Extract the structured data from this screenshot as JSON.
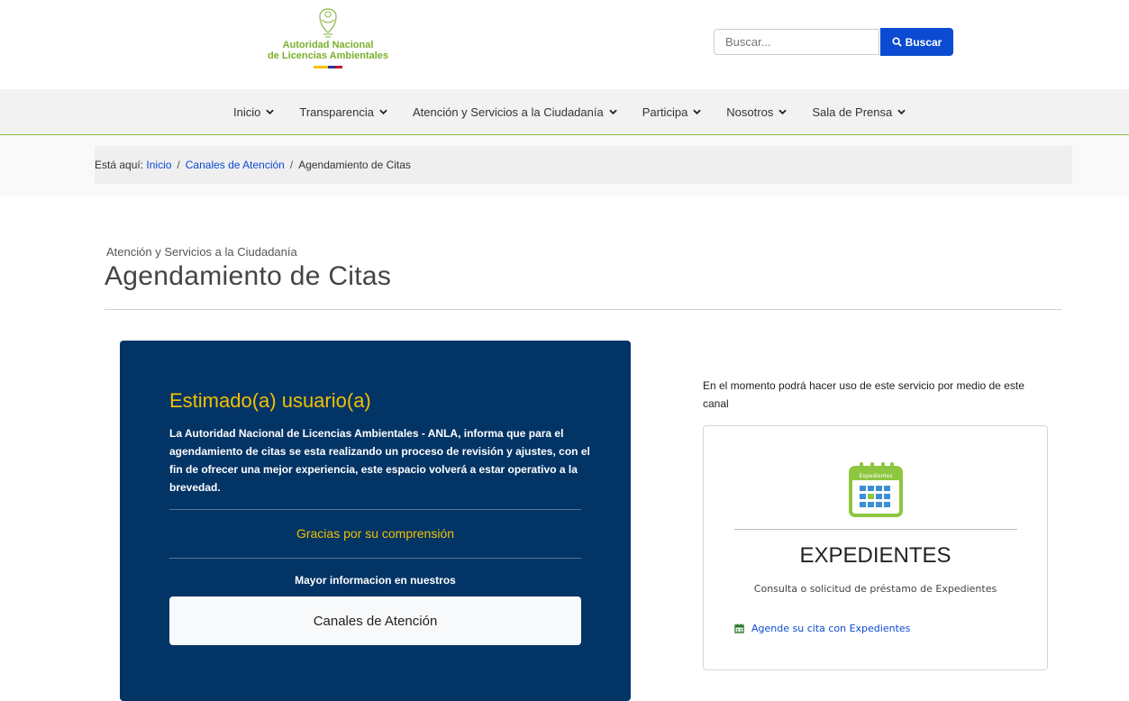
{
  "header": {
    "logo_line1": "Autoridad Nacional",
    "logo_line2": "de Licencias Ambientales",
    "search_placeholder": "Buscar...",
    "search_button": "Buscar"
  },
  "nav": {
    "items": [
      {
        "label": "Inicio"
      },
      {
        "label": "Transparencia"
      },
      {
        "label": "Atención y Servicios a la Ciudadanía"
      },
      {
        "label": "Participa"
      },
      {
        "label": "Nosotros"
      },
      {
        "label": "Sala de Prensa"
      }
    ]
  },
  "breadcrumb": {
    "prefix": "Está aquí:",
    "links": [
      "Inicio",
      "Canales de Atención"
    ],
    "separator": "/",
    "current": "Agendamiento de Citas"
  },
  "page": {
    "kicker": "Atención y Servicios a la Ciudadanía",
    "title": "Agendamiento de Citas"
  },
  "notice": {
    "heading": "Estimado(a) usuario(a)",
    "body": "La Autoridad Nacional de Licencias Ambientales - ANLA, informa que para el agendamiento de citas se esta realizando un proceso de revisión y ajustes, con el fin de ofrecer una mejor experiencia, este espacio volverá a estar operativo a la brevedad.",
    "thanks": "Gracias por su comprensión",
    "more": "Mayor informacion en nuestros",
    "button": "Canales de Atención"
  },
  "side": {
    "intro": "En el momento podrá hacer uso de este servicio por medio de este canal",
    "card": {
      "icon_label": "Expedientes",
      "title": "EXPEDIENTES",
      "description": "Consulta o solicitud de préstamo de Expedientes",
      "link": "Agende su cita con Expedientes"
    }
  },
  "colors": {
    "brand_green": "#7ab02d",
    "primary_blue": "#0b4bd1",
    "panel_navy": "#033466",
    "accent_yellow": "#f2c000"
  }
}
